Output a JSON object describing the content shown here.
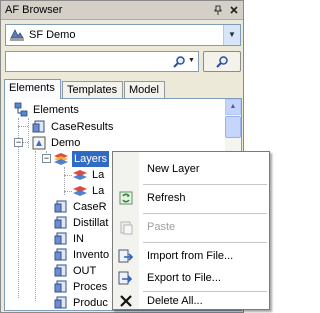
{
  "panel": {
    "title": "AF Browser",
    "pin_icon": "pin-icon",
    "close_icon": "close-icon"
  },
  "database_combo": {
    "value": "SF Demo",
    "icon": "database-icon"
  },
  "search": {
    "value": "",
    "icon": "search-icon"
  },
  "tabs": [
    {
      "label": "Elements",
      "active": true
    },
    {
      "label": "Templates",
      "active": false
    },
    {
      "label": "Model",
      "active": false
    }
  ],
  "tree": {
    "root": "Elements",
    "case_results": "CaseResults",
    "demo": "Demo",
    "layers": "Layers",
    "layer_child_1": "La",
    "layer_child_2": "La",
    "case_r": "CaseR",
    "distillat": "Distillat",
    "in": "IN",
    "invento": "Invento",
    "out": "OUT",
    "proces": "Proces",
    "produc": "Produc"
  },
  "context_menu": {
    "new_layer": "New Layer",
    "refresh": "Refresh",
    "paste": "Paste",
    "import": "Import from File...",
    "export": "Export to File...",
    "delete_all": "Delete All..."
  },
  "colors": {
    "panel_bg": "#ece9d8",
    "selection": "#316ac5",
    "border": "#7f9db9"
  }
}
